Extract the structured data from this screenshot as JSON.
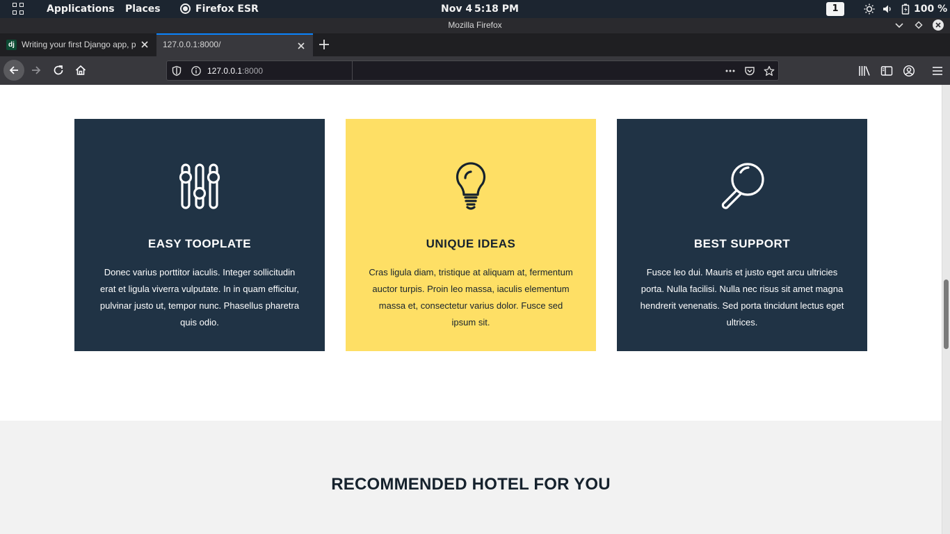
{
  "system_bar": {
    "applications": "Applications",
    "places": "Places",
    "active_app": "Firefox ESR",
    "date": "Nov 4",
    "time": "5:18 PM",
    "workspace": "1",
    "battery": "100 %"
  },
  "window": {
    "title": "Mozilla Firefox"
  },
  "tabs": [
    {
      "title": "Writing your first Django app, pa",
      "favicon": "dj",
      "active": false
    },
    {
      "title": "127.0.0.1:8000/",
      "active": true
    }
  ],
  "urlbar": {
    "host": "127.0.0.1",
    "port": ":8000"
  },
  "cards": [
    {
      "icon": "sliders-icon",
      "title": "EASY TOOPLATE",
      "text": "Donec varius porttitor iaculis. Integer sollicitudin erat et ligula viverra vulputate. In in quam efficitur, pulvinar justo ut, tempor nunc. Phasellus pharetra quis odio."
    },
    {
      "icon": "lightbulb-icon",
      "title": "UNIQUE IDEAS",
      "text": "Cras ligula diam, tristique at aliquam at, fermentum auctor turpis. Proin leo massa, iaculis elementum massa et, consectetur varius dolor. Fusce sed ipsum sit."
    },
    {
      "icon": "magnifier-icon",
      "title": "BEST SUPPORT",
      "text": "Fusce leo dui. Mauris et justo eget arcu ultricies porta. Nulla facilisi. Nulla nec risus sit amet magna hendrerit venenatis. Sed porta tincidunt lectus eget ultrices."
    }
  ],
  "section": {
    "heading": "RECOMMENDED HOTEL FOR YOU"
  },
  "colors": {
    "card_dark": "#203345",
    "card_yellow": "#fedf65",
    "section_bg": "#f2f2f2",
    "tab_accent": "#0a84ff"
  }
}
